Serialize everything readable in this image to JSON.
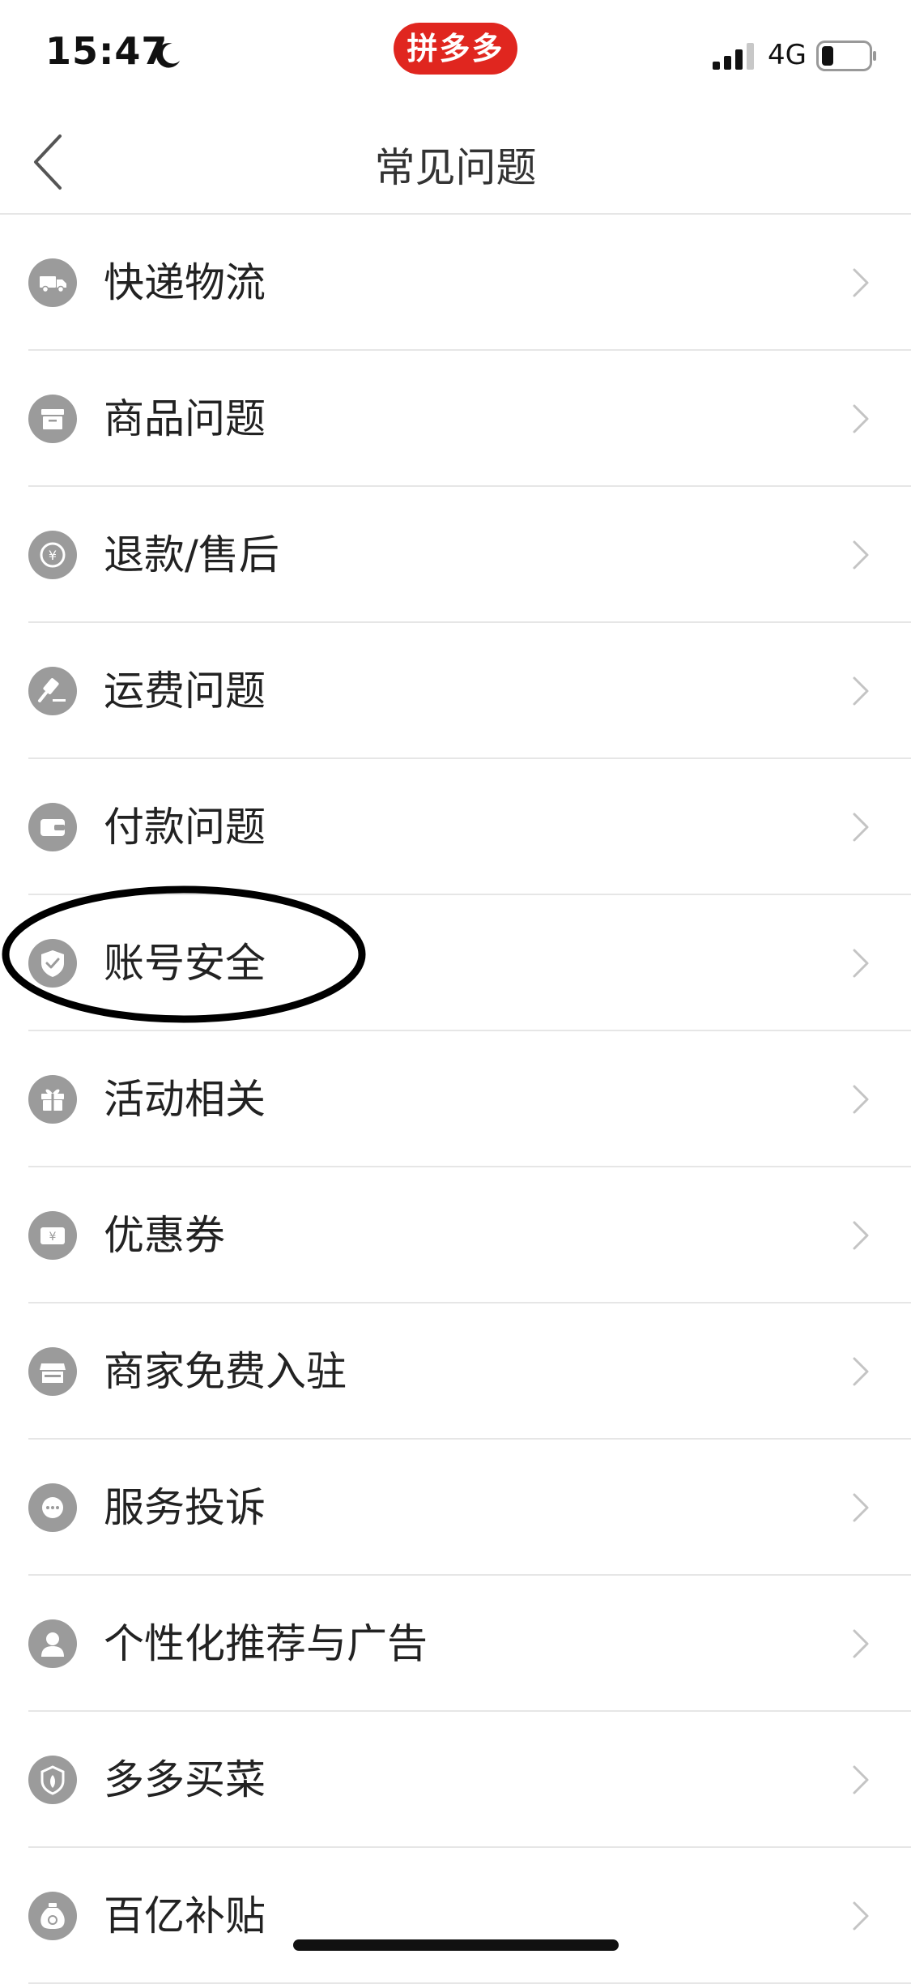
{
  "status_bar": {
    "time": "15:47",
    "app_name": "拼多多",
    "network": "4G",
    "icons": [
      "moon-icon",
      "signal-icon",
      "battery-icon"
    ]
  },
  "nav": {
    "title": "常见问题",
    "back_icon": "chevron-left-icon"
  },
  "items": [
    {
      "label": "快递物流",
      "icon": "truck-icon"
    },
    {
      "label": "商品问题",
      "icon": "box-icon"
    },
    {
      "label": "退款/售后",
      "icon": "yuan-coin-icon"
    },
    {
      "label": "运费问题",
      "icon": "gavel-icon"
    },
    {
      "label": "付款问题",
      "icon": "wallet-icon"
    },
    {
      "label": "账号安全",
      "icon": "shield-icon"
    },
    {
      "label": "活动相关",
      "icon": "gift-icon"
    },
    {
      "label": "优惠券",
      "icon": "coupon-icon"
    },
    {
      "label": "商家免费入驻",
      "icon": "store-icon"
    },
    {
      "label": "服务投诉",
      "icon": "chat-bubble-icon"
    },
    {
      "label": "个性化推荐与广告",
      "icon": "person-icon"
    },
    {
      "label": "多多买菜",
      "icon": "vegetable-badge-icon"
    },
    {
      "label": "百亿补贴",
      "icon": "money-bag-icon"
    }
  ],
  "colors": {
    "brand_red": "#e0261f",
    "icon_gray": "#9b9b9b",
    "divider": "#e6e6e6",
    "text": "#222222",
    "annotation": "#000000"
  }
}
